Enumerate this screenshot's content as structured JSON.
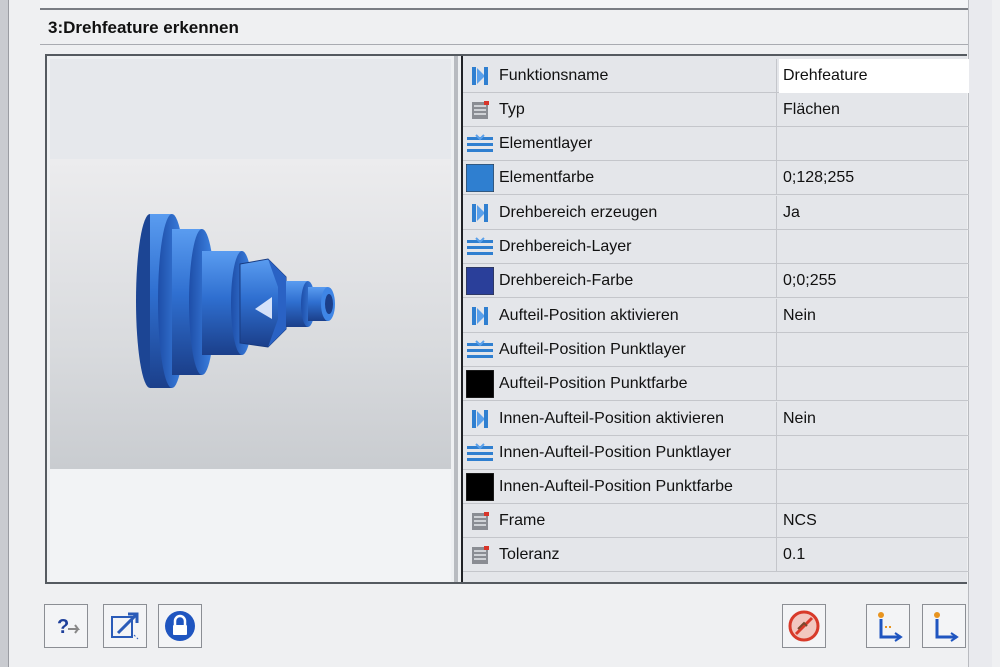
{
  "dialog": {
    "title": "3:Drehfeature erkennen"
  },
  "properties": [
    {
      "icon": "function-icon",
      "name": "Funktionsname",
      "value": "Drehfeature"
    },
    {
      "icon": "list-icon",
      "name": "Typ",
      "value": "Flächen"
    },
    {
      "icon": "layer-icon",
      "name": "Elementlayer",
      "value": ""
    },
    {
      "icon": "color-swatch-icon",
      "name": "Elementfarbe",
      "value": "0;128;255",
      "swatch": "#2f7fd0"
    },
    {
      "icon": "function-icon",
      "name": "Drehbereich erzeugen",
      "value": "Ja"
    },
    {
      "icon": "layer-icon",
      "name": "Drehbereich-Layer",
      "value": ""
    },
    {
      "icon": "color-swatch-icon",
      "name": "Drehbereich-Farbe",
      "value": "0;0;255",
      "swatch": "#2a3f9a"
    },
    {
      "icon": "function-icon",
      "name": "Aufteil-Position aktivieren",
      "value": "Nein"
    },
    {
      "icon": "layer-icon",
      "name": "Aufteil-Position Punktlayer",
      "value": ""
    },
    {
      "icon": "color-swatch-icon",
      "name": "Aufteil-Position Punktfarbe",
      "value": "",
      "swatch": "#000000"
    },
    {
      "icon": "function-icon",
      "name": "Innen-Aufteil-Position aktivieren",
      "value": "Nein"
    },
    {
      "icon": "layer-icon",
      "name": "Innen-Aufteil-Position Punktlayer",
      "value": ""
    },
    {
      "icon": "color-swatch-icon",
      "name": "Innen-Aufteil-Position Punktfarbe",
      "value": "",
      "swatch": "#000000"
    },
    {
      "icon": "list-icon",
      "name": "Frame",
      "value": "NCS"
    },
    {
      "icon": "list-icon",
      "name": "Toleranz",
      "value": "0.1"
    }
  ],
  "colors": {
    "part_blue": "#2f6fd0",
    "icon_blue": "#2f7fd0"
  },
  "buttons": [
    {
      "name": "help-button",
      "icon": "help-icon"
    },
    {
      "name": "edit-button",
      "icon": "edit-arrow-icon"
    },
    {
      "name": "lock-button",
      "icon": "lock-icon"
    },
    {
      "name": "no-entry-button",
      "icon": "prohibited-icon"
    },
    {
      "name": "previous-step-button",
      "icon": "step-back-icon"
    },
    {
      "name": "next-step-button",
      "icon": "step-forward-icon"
    }
  ]
}
